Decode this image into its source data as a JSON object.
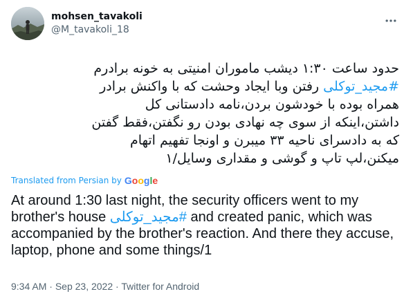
{
  "user": {
    "display_name": "mohsen_tavakoli",
    "handle": "@M_tavakoli_18"
  },
  "icons": {
    "more": "more-icon"
  },
  "tweet": {
    "persian_line1": "حدود ساعت ۱:۳۰ دیشب ماموران امنیتی به خونه برادرم",
    "persian_hashtag": "#مجید_توکلی",
    "persian_line2_rest": " رفتن وبا ایجاد وحشت که با واکنش برادر",
    "persian_line3": "همراه بوده با خودشون بردن،نامه دادستانی کل",
    "persian_line4": "داشتن،اینکه از سوی چه نهادی بودن رو نگفتن،فقط گفتن",
    "persian_line5": "که به دادسرای ناحیه ۳۳ میبرن و اونجا تفهیم اتهام",
    "persian_line6": "میکنن،لپ تاپ و گوشی و مقداری وسایل/۱"
  },
  "translation": {
    "label": "Translated from Persian by",
    "provider_letters": [
      "G",
      "o",
      "o",
      "g",
      "l",
      "e"
    ],
    "text_part1": "At around 1:30 last night, the security officers went to my brother's house ",
    "hashtag": "#مجید_توکلی",
    "text_part2": " and created panic, which was accompanied by the brother's reaction. And there they accuse, laptop, phone and some things/1"
  },
  "meta": {
    "time": "9:34 AM",
    "separator1": " · ",
    "date": "Sep 23, 2022",
    "separator2": " · ",
    "source": "Twitter for Android"
  },
  "colors": {
    "link": "#1d9bf0",
    "secondary_text": "#536471",
    "primary_text": "#0f1419"
  }
}
